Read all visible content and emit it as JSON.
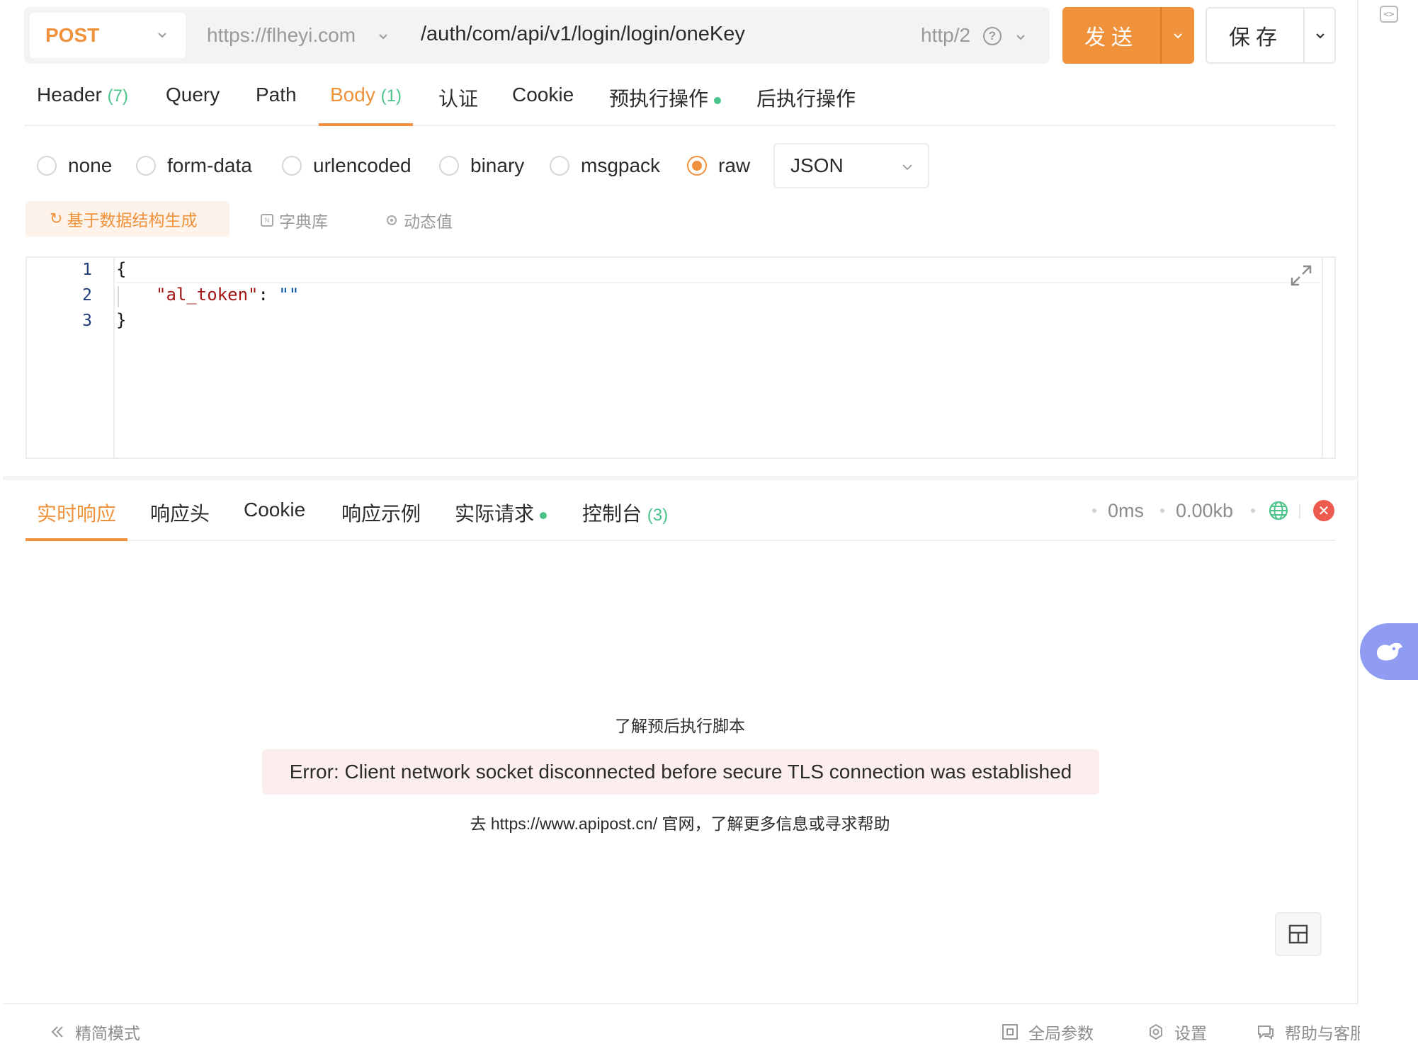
{
  "urlbar": {
    "method": "POST",
    "host": "https://flheyi.com",
    "path": "/auth/com/api/v1/login/login/oneKey",
    "protocol": "http/2"
  },
  "actions": {
    "send_label": "发送",
    "save_label": "保存"
  },
  "request_tabs": [
    {
      "label": "Header",
      "count": "(7)"
    },
    {
      "label": "Query"
    },
    {
      "label": "Path"
    },
    {
      "label": "Body",
      "count": "(1)",
      "active": true
    },
    {
      "label": "认证"
    },
    {
      "label": "Cookie"
    },
    {
      "label": "预执行操作",
      "dot": true
    },
    {
      "label": "后执行操作"
    }
  ],
  "body_types": [
    {
      "label": "none"
    },
    {
      "label": "form-data"
    },
    {
      "label": "urlencoded"
    },
    {
      "label": "binary"
    },
    {
      "label": "msgpack"
    },
    {
      "label": "raw",
      "selected": true
    }
  ],
  "raw_format": "JSON",
  "tools": {
    "generate_label": "基于数据结构生成",
    "dictionary_label": "字典库",
    "dynamic_label": "动态值"
  },
  "editor": {
    "line_numbers": [
      "1",
      "2",
      "3"
    ],
    "line1": "{",
    "line2_key": "\"al_token\"",
    "line2_colon": ": ",
    "line2_value": "\"\"",
    "line3": "}"
  },
  "response_tabs": [
    {
      "label": "实时响应",
      "active": true
    },
    {
      "label": "响应头"
    },
    {
      "label": "Cookie"
    },
    {
      "label": "响应示例"
    },
    {
      "label": "实际请求",
      "dot": true
    },
    {
      "label": "控制台",
      "count": "(3)"
    }
  ],
  "response_meta": {
    "time": "0ms",
    "size": "0.00kb"
  },
  "response": {
    "learn_link": "了解预后执行脚本",
    "error": "Error: Client network socket disconnected before secure TLS connection was established",
    "help_text": "去 https://www.apipost.cn/ 官网，了解更多信息或寻求帮助"
  },
  "footer": {
    "compact_mode": "精简模式",
    "global_params": "全局参数",
    "settings": "设置",
    "help": "帮助与客服"
  },
  "colors": {
    "accent": "#f0923b",
    "success": "#4cc38a",
    "error": "#ec5b4e",
    "error_bg": "#fdeeee"
  }
}
